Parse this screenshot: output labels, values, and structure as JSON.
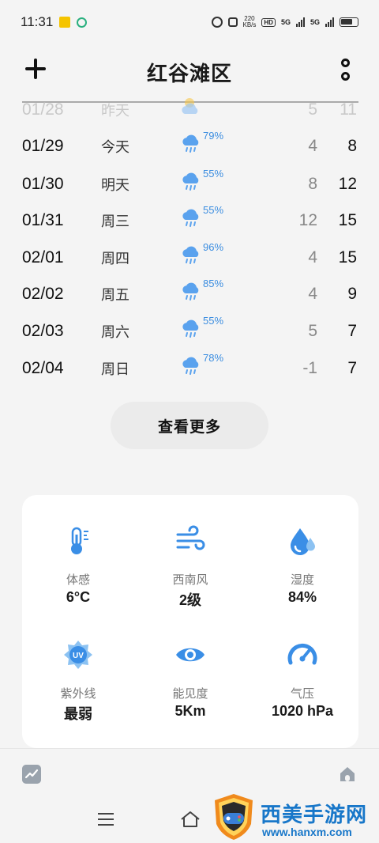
{
  "status_bar": {
    "time": "11:31",
    "speed_value": "220",
    "speed_unit": "KB/s",
    "hd": "HD",
    "net1": "5G",
    "net2": "5G"
  },
  "header": {
    "title": "红谷滩区"
  },
  "forecast": [
    {
      "date": "01/28",
      "day": "昨天",
      "icon": "partly-cloudy-icon",
      "precip": "",
      "low": "5",
      "high": "11",
      "faded": true
    },
    {
      "date": "01/29",
      "day": "今天",
      "icon": "rain-icon",
      "precip": "79%",
      "low": "4",
      "high": "8"
    },
    {
      "date": "01/30",
      "day": "明天",
      "icon": "rain-icon",
      "precip": "55%",
      "low": "8",
      "high": "12"
    },
    {
      "date": "01/31",
      "day": "周三",
      "icon": "rain-icon",
      "precip": "55%",
      "low": "12",
      "high": "15"
    },
    {
      "date": "02/01",
      "day": "周四",
      "icon": "rain-icon",
      "precip": "96%",
      "low": "4",
      "high": "15"
    },
    {
      "date": "02/02",
      "day": "周五",
      "icon": "rain-icon",
      "precip": "85%",
      "low": "4",
      "high": "9"
    },
    {
      "date": "02/03",
      "day": "周六",
      "icon": "rain-icon",
      "precip": "55%",
      "low": "5",
      "high": "7"
    },
    {
      "date": "02/04",
      "day": "周日",
      "icon": "rain-icon",
      "precip": "78%",
      "low": "-1",
      "high": "7"
    }
  ],
  "more_button": "查看更多",
  "details": [
    {
      "label": "体感",
      "value": "6°C",
      "icon": "thermometer-icon"
    },
    {
      "label": "西南风",
      "value": "2级",
      "icon": "wind-icon"
    },
    {
      "label": "湿度",
      "value": "84%",
      "icon": "humidity-icon"
    },
    {
      "label": "紫外线",
      "value": "最弱",
      "icon": "uv-icon"
    },
    {
      "label": "能见度",
      "value": "5Km",
      "icon": "eye-icon"
    },
    {
      "label": "气压",
      "value": "1020 hPa",
      "icon": "gauge-icon"
    }
  ],
  "uv_icon_text": "UV",
  "watermark": {
    "title": "西美手游网",
    "url": "www.hanxm.com"
  },
  "colors": {
    "accent": "#3b8de0",
    "icon_blue": "#3a8ee6",
    "background": "#f4f4f4"
  }
}
